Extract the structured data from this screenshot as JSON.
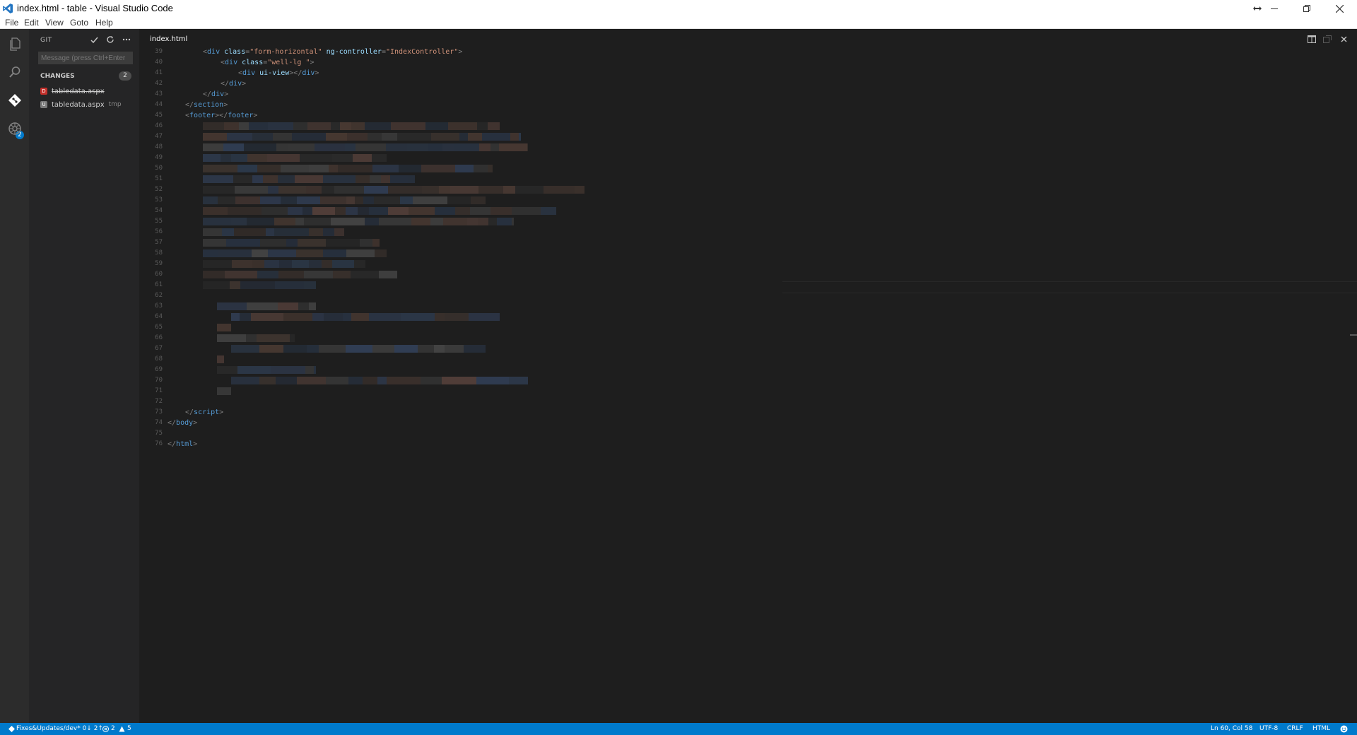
{
  "window": {
    "title": "index.html - table - Visual Studio Code"
  },
  "menu": [
    "File",
    "Edit",
    "View",
    "Goto",
    "Help"
  ],
  "activitybar": {
    "icons": [
      "files-icon",
      "search-icon",
      "git-icon",
      "debug-icon"
    ],
    "git_badge": "2"
  },
  "sidebar": {
    "header": "GIT",
    "message_placeholder": "Message (press Ctrl+Enter",
    "changes_label": "CHANGES",
    "changes_count": "2",
    "files": [
      {
        "badge": "D",
        "name": "tabledata.aspx",
        "hint": ""
      },
      {
        "badge": "U",
        "name": "tabledata.aspx",
        "hint": "tmp"
      }
    ]
  },
  "editor": {
    "tab": "index.html",
    "lines": [
      {
        "num": "39"
      },
      {
        "num": "40"
      },
      {
        "num": "41"
      },
      {
        "num": "42"
      },
      {
        "num": "43"
      },
      {
        "num": "44"
      },
      {
        "num": "45"
      },
      {
        "num": "46"
      },
      {
        "num": "47"
      },
      {
        "num": "48"
      },
      {
        "num": "49"
      },
      {
        "num": "50"
      },
      {
        "num": "51"
      },
      {
        "num": "52"
      },
      {
        "num": "53"
      },
      {
        "num": "54"
      },
      {
        "num": "55"
      },
      {
        "num": "56"
      },
      {
        "num": "57"
      },
      {
        "num": "58"
      },
      {
        "num": "59"
      },
      {
        "num": "60"
      },
      {
        "num": "61"
      },
      {
        "num": "62"
      },
      {
        "num": "63"
      },
      {
        "num": "64"
      },
      {
        "num": "65"
      },
      {
        "num": "66"
      },
      {
        "num": "67"
      },
      {
        "num": "68"
      },
      {
        "num": "69"
      },
      {
        "num": "70"
      },
      {
        "num": "71"
      },
      {
        "num": "72"
      },
      {
        "num": "73"
      },
      {
        "num": "74"
      },
      {
        "num": "75"
      },
      {
        "num": "76"
      }
    ],
    "code": {
      "l39": {
        "tag": "div",
        "attr1": "class",
        "val1": "\"form-horizontal\"",
        "attr2": "ng-controller",
        "val2": "\"IndexController\""
      },
      "l40": {
        "tag": "div",
        "attr1": "class",
        "val1": "\"well-lg \""
      },
      "l41": {
        "tag": "div",
        "attr1": "ui-view",
        "close": "div"
      },
      "l42": {
        "close": "div"
      },
      "l43": {
        "close": "div"
      },
      "l44": {
        "close": "section"
      },
      "l45": {
        "tag": "footer",
        "close": "footer"
      },
      "l73": {
        "close": "script"
      },
      "l74": {
        "close": "body"
      },
      "l76": {
        "close": "html"
      }
    }
  },
  "statusbar": {
    "branch": "Fixes&Updates/dev* 0↓ 2↑",
    "errors": "2",
    "warnings": "5",
    "position": "Ln 60, Col 58",
    "encoding": "UTF-8",
    "eol": "CRLF",
    "language": "HTML"
  }
}
